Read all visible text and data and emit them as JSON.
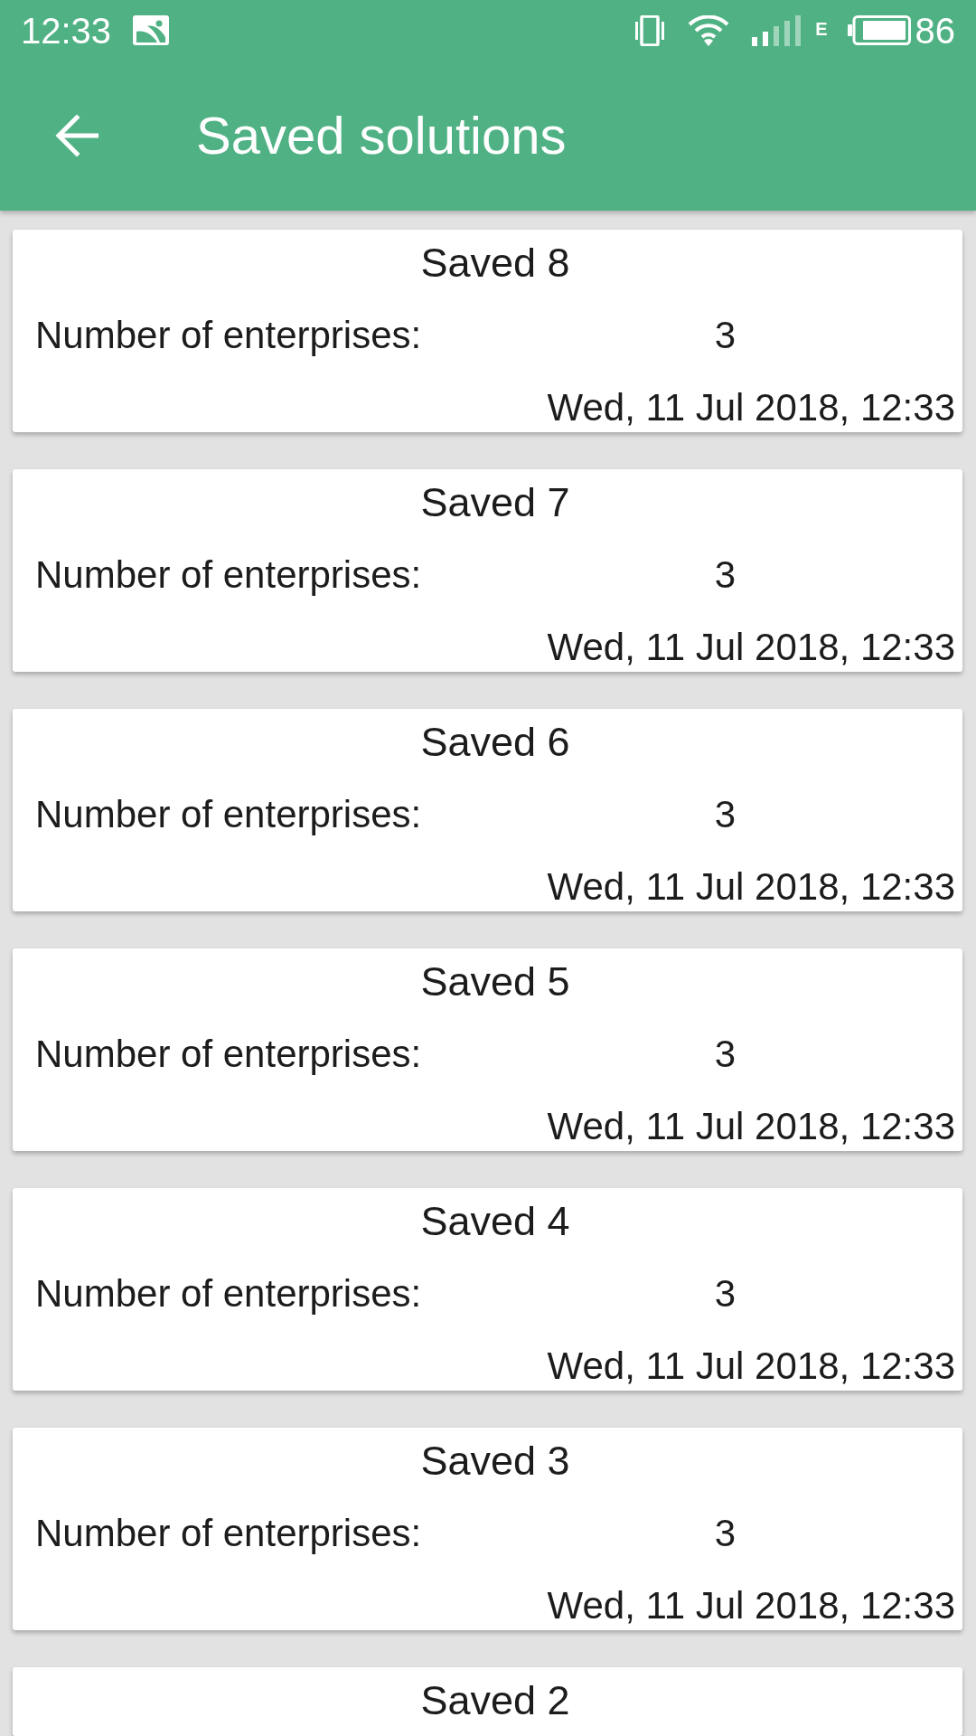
{
  "status_bar": {
    "time": "12:33",
    "network_type": "E",
    "battery": "86"
  },
  "app_bar": {
    "title": "Saved solutions"
  },
  "solutions": [
    {
      "title": "Saved 8",
      "count_label": "Number of enterprises:",
      "count": "3",
      "date": "Wed, 11 Jul 2018, 12:33"
    },
    {
      "title": "Saved 7",
      "count_label": "Number of enterprises:",
      "count": "3",
      "date": "Wed, 11 Jul 2018, 12:33"
    },
    {
      "title": "Saved 6",
      "count_label": "Number of enterprises:",
      "count": "3",
      "date": "Wed, 11 Jul 2018, 12:33"
    },
    {
      "title": "Saved 5",
      "count_label": "Number of enterprises:",
      "count": "3",
      "date": "Wed, 11 Jul 2018, 12:33"
    },
    {
      "title": "Saved 4",
      "count_label": "Number of enterprises:",
      "count": "3",
      "date": "Wed, 11 Jul 2018, 12:33"
    },
    {
      "title": "Saved 3",
      "count_label": "Number of enterprises:",
      "count": "3",
      "date": "Wed, 11 Jul 2018, 12:33"
    },
    {
      "title": "Saved 2"
    }
  ]
}
